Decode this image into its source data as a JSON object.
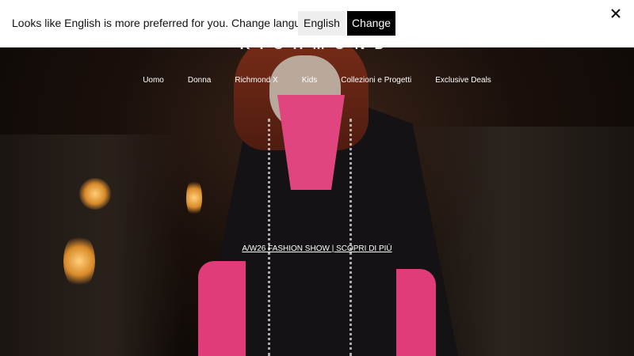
{
  "language_banner": {
    "message": "Looks like English is more preferred for you. Change language?",
    "selected_language": "English",
    "change_label": "Change",
    "close_icon": "close-icon"
  },
  "header": {
    "logo": "RICHMOND",
    "icons": [
      "search-icon",
      "account-icon",
      "cart-icon"
    ]
  },
  "nav": {
    "items": [
      {
        "label": "Uomo"
      },
      {
        "label": "Donna"
      },
      {
        "label": "Richmond X"
      },
      {
        "label": "Kids"
      },
      {
        "label": "Collezioni e Progetti"
      },
      {
        "label": "Exclusive Deals"
      }
    ]
  },
  "hero": {
    "cta": "A/W26 FASHION SHOW | SCOPRI DI PIÙ"
  },
  "colors": {
    "accent_pink": "#e0457f",
    "banner_bg": "#ffffff",
    "button_bg": "#000000"
  }
}
